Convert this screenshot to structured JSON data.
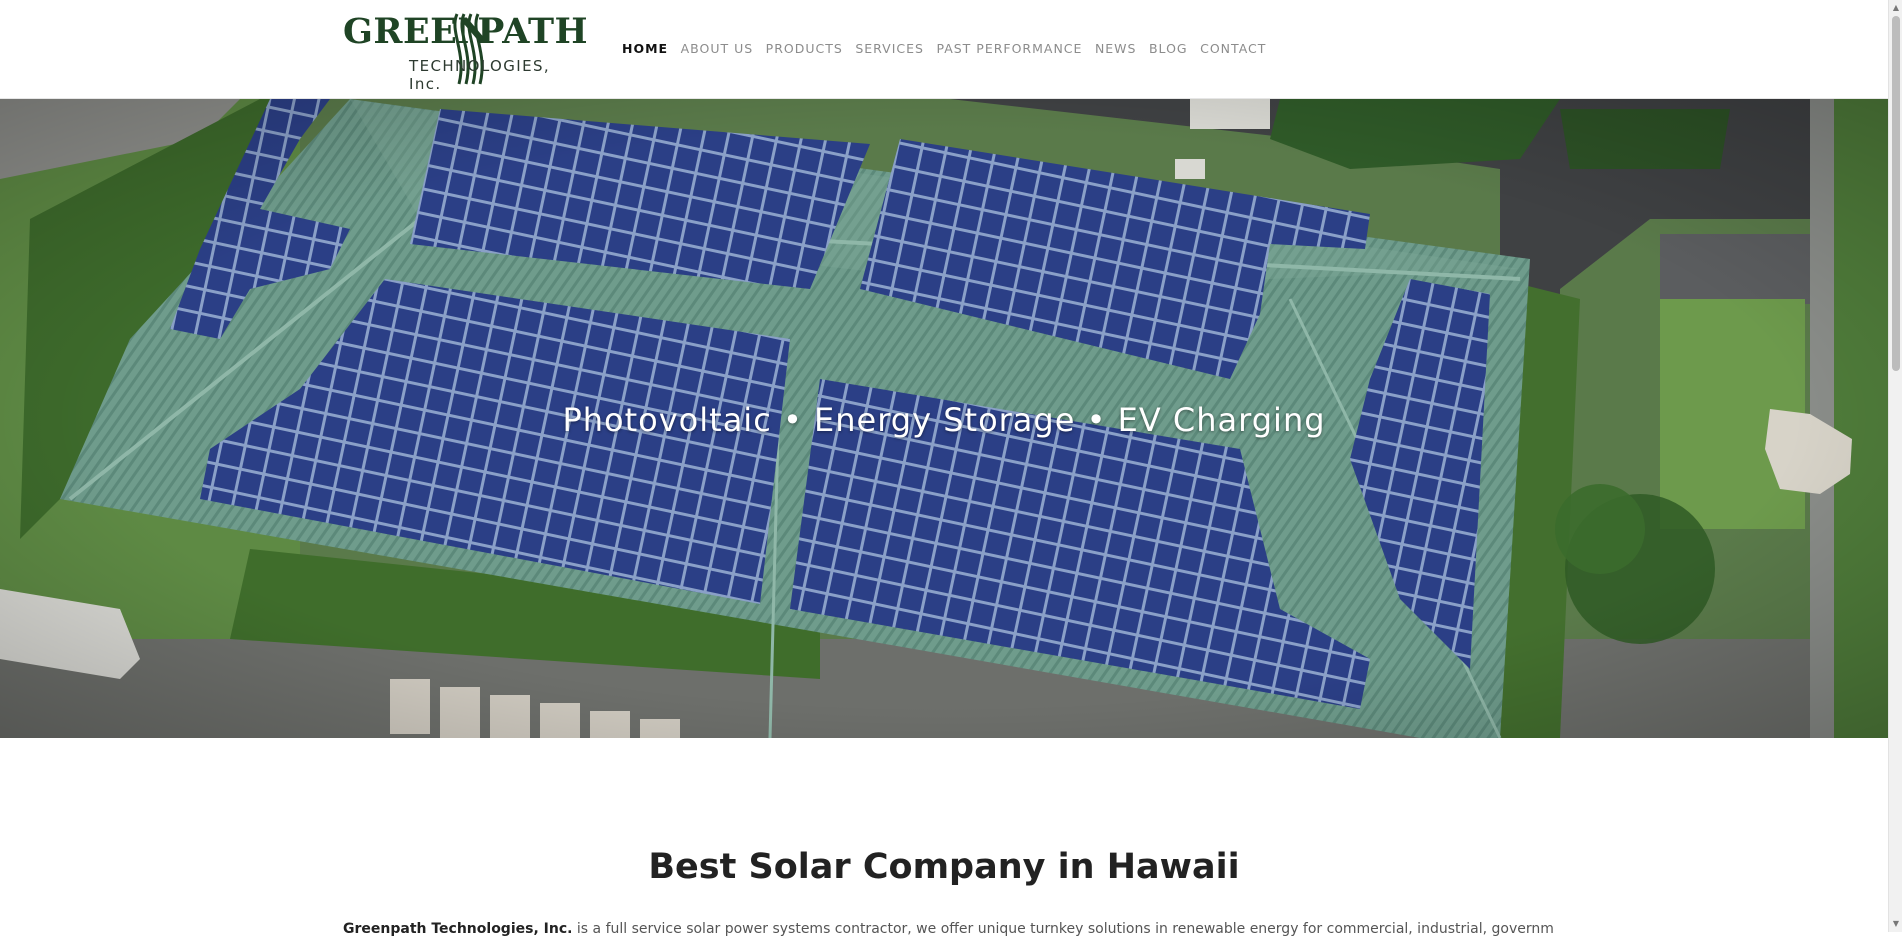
{
  "header": {
    "logo": {
      "word1": "GREEN",
      "word2": "PATH",
      "tagline": "TECHNOLOGIES, Inc."
    },
    "nav": [
      {
        "label": "HOME",
        "active": true
      },
      {
        "label": "ABOUT US"
      },
      {
        "label": "PRODUCTS"
      },
      {
        "label": "SERVICES"
      },
      {
        "label": "PAST PERFORMANCE"
      },
      {
        "label": "NEWS"
      },
      {
        "label": "BLOG"
      },
      {
        "label": "CONTACT"
      }
    ]
  },
  "hero": {
    "headline": "Photovoltaic • Energy Storage • EV Charging"
  },
  "main": {
    "title": "Best Solar Company in Hawaii",
    "intro_company": "Greenpath Technologies, Inc.",
    "intro_text": " is a full service solar power systems contractor, we offer unique turnkey solutions in renewable energy for commercial, industrial, government"
  },
  "colors": {
    "brand_green": "#1f4425",
    "nav_active": "#111111",
    "nav_inactive": "#8c8c8c",
    "roof_green": "#6f9c8c",
    "panel_blue": "#2b3f86"
  }
}
